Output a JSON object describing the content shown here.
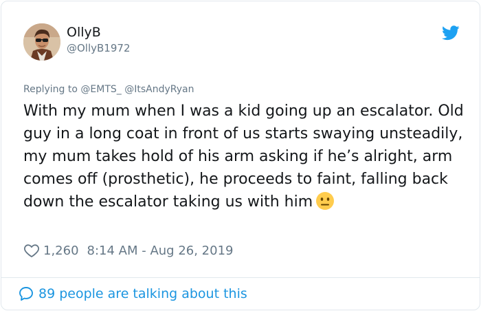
{
  "tweet": {
    "author_name": "OllyB",
    "author_handle": "@OllyB1972",
    "reply_prefix": "Replying to",
    "reply_mentions": [
      "@EMTS_",
      "@ItsAndyRyan"
    ],
    "text": "With my mum when I was a kid going up an escalator.  Old guy in a long coat in front of us starts swaying unsteadily, my mum takes hold of his arm asking if he’s alright, arm comes off (prosthetic), he proceeds to faint, falling back down the escalator taking us with him",
    "emoji": "neutral-face-emoji",
    "likes": "1,260",
    "timestamp": "8:14 AM - Aug 26, 2019",
    "footer_text": "89 people are talking about this"
  },
  "icons": {
    "brand": "twitter-bird-icon",
    "like": "heart-icon",
    "conversation": "speech-bubble-icon"
  },
  "colors": {
    "twitter_blue": "#1da1f2",
    "link_blue": "#1b95e0",
    "text": "#14171a",
    "secondary": "#657786",
    "border": "#e1e8ed"
  }
}
